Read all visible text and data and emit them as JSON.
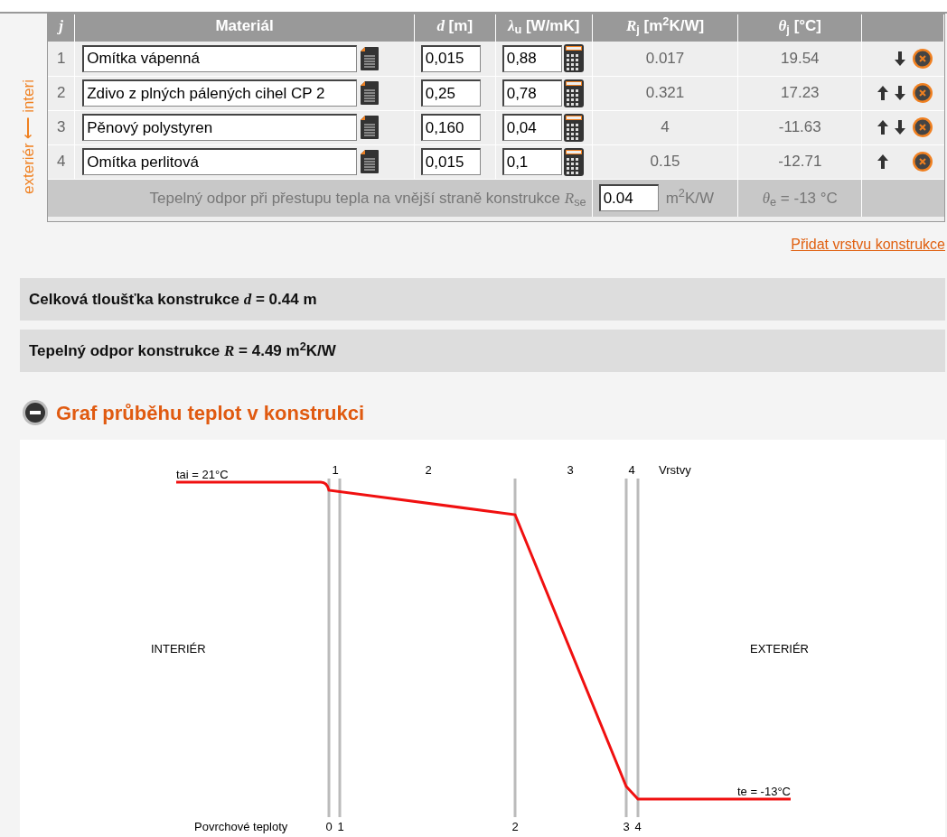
{
  "side_label": "exteriér ⟵ interi",
  "table": {
    "columns": [
      "j",
      "Materiál",
      "*d* [m]",
      "*λ*$_{u}$ [W/mK]",
      "*R*$_{j}$ [m$^{2}$K/W]",
      "*θ*$_{j}$ [°C]"
    ],
    "rows": [
      {
        "index": "1",
        "material": "Omítka vápenná",
        "d": "0,015",
        "lambda": "0,88",
        "r": "0.017",
        "theta": "19.54",
        "up": false,
        "down": true
      },
      {
        "index": "2",
        "material": "Zdivo z plných pálených cihel CP 2",
        "d": "0,25",
        "lambda": "0,78",
        "r": "0.321",
        "theta": "17.23",
        "up": true,
        "down": true
      },
      {
        "index": "3",
        "material": "Pěnový polystyren",
        "d": "0,160",
        "lambda": "0,04",
        "r": "4",
        "theta": "-11.63",
        "up": true,
        "down": true
      },
      {
        "index": "4",
        "material": "Omítka perlitová",
        "d": "0,015",
        "lambda": "0,1",
        "r": "0.15",
        "theta": "-12.71",
        "up": true,
        "down": false
      }
    ],
    "footer": {
      "label": "Tepelný odpor při přestupu tepla na vnější straně konstrukce *R*$_{se}$",
      "value": "0.04",
      "unit": "m$^{2}$K/W",
      "theta": "*θ*$_{e}$ = -13 °C"
    }
  },
  "add_layer_link": "Přidat vrstvu konstrukce",
  "summary": [
    "Celková tloušťka konstrukce *d* = 0.44 m",
    "Tepelný odpor konstrukce *R* = 4.49 m$^{2}$K/W"
  ],
  "section": {
    "title": "Graf průběhu teplot v konstrukci",
    "expanded": true
  },
  "graph": {
    "t_interior": "tai = 21°C",
    "t_exterior": "te = -13°C",
    "interior": "INTERIÉR",
    "exterior": "EXTERIÉR",
    "layers_label": "Vrstvy",
    "layers": [
      "1",
      "2",
      "3",
      "4"
    ],
    "surfaces_label": "Povrchové teploty",
    "surfaces": [
      "0",
      "1",
      "2",
      "3",
      "4"
    ]
  }
}
